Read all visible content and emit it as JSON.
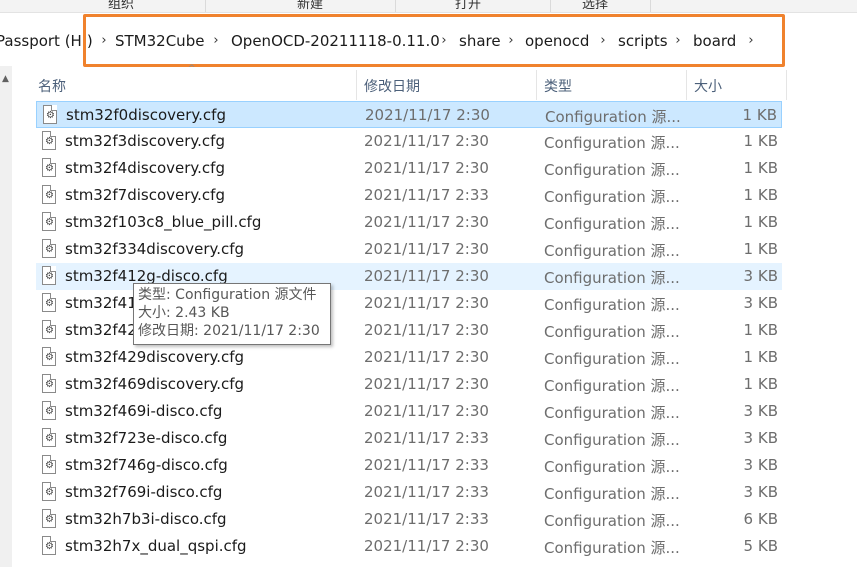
{
  "ribbon": {
    "groups": [
      "组织",
      "新建",
      "打开",
      "选择"
    ]
  },
  "breadcrumb": {
    "items": [
      "Passport (H:)",
      "STM32Cube",
      "OpenOCD-20211118-0.11.0",
      "share",
      "openocd",
      "scripts",
      "board"
    ],
    "highlight_color": "#f0822d"
  },
  "columns": {
    "name": "名称",
    "date": "修改日期",
    "type": "类型",
    "size": "大小"
  },
  "files": [
    {
      "name": "stm32f0discovery.cfg",
      "date": "2021/11/17 2:30",
      "type": "Configuration 源...",
      "size": "1 KB"
    },
    {
      "name": "stm32f3discovery.cfg",
      "date": "2021/11/17 2:30",
      "type": "Configuration 源...",
      "size": "1 KB"
    },
    {
      "name": "stm32f4discovery.cfg",
      "date": "2021/11/17 2:30",
      "type": "Configuration 源...",
      "size": "1 KB"
    },
    {
      "name": "stm32f7discovery.cfg",
      "date": "2021/11/17 2:33",
      "type": "Configuration 源...",
      "size": "1 KB"
    },
    {
      "name": "stm32f103c8_blue_pill.cfg",
      "date": "2021/11/17 2:30",
      "type": "Configuration 源...",
      "size": "1 KB"
    },
    {
      "name": "stm32f334discovery.cfg",
      "date": "2021/11/17 2:30",
      "type": "Configuration 源...",
      "size": "1 KB"
    },
    {
      "name": "stm32f412g-disco.cfg",
      "date": "2021/11/17 2:30",
      "type": "Configuration 源...",
      "size": "3 KB"
    },
    {
      "name": "stm32f41",
      "date": "2021/11/17 2:30",
      "type": "Configuration 源...",
      "size": "3 KB"
    },
    {
      "name": "stm32f42",
      "date": "2021/11/17 2:30",
      "type": "Configuration 源...",
      "size": "1 KB"
    },
    {
      "name": "stm32f429discovery.cfg",
      "date": "2021/11/17 2:30",
      "type": "Configuration 源...",
      "size": "1 KB"
    },
    {
      "name": "stm32f469discovery.cfg",
      "date": "2021/11/17 2:30",
      "type": "Configuration 源...",
      "size": "1 KB"
    },
    {
      "name": "stm32f469i-disco.cfg",
      "date": "2021/11/17 2:30",
      "type": "Configuration 源...",
      "size": "3 KB"
    },
    {
      "name": "stm32f723e-disco.cfg",
      "date": "2021/11/17 2:33",
      "type": "Configuration 源...",
      "size": "3 KB"
    },
    {
      "name": "stm32f746g-disco.cfg",
      "date": "2021/11/17 2:33",
      "type": "Configuration 源...",
      "size": "3 KB"
    },
    {
      "name": "stm32f769i-disco.cfg",
      "date": "2021/11/17 2:33",
      "type": "Configuration 源...",
      "size": "3 KB"
    },
    {
      "name": "stm32h7b3i-disco.cfg",
      "date": "2021/11/17 2:33",
      "type": "Configuration 源...",
      "size": "6 KB"
    },
    {
      "name": "stm32h7x_dual_qspi.cfg",
      "date": "2021/11/17 2:30",
      "type": "Configuration 源...",
      "size": "5 KB"
    }
  ],
  "tooltip": {
    "type_line": "类型: Configuration 源文件",
    "size_line": "大小: 2.43 KB",
    "date_line": "修改日期: 2021/11/17 2:30"
  },
  "colors": {
    "selected_bg": "#cce8ff",
    "hover_bg": "#e5f3ff"
  },
  "icons": {
    "file": "cfg-file-icon",
    "chevron": "chevron-right-icon"
  }
}
